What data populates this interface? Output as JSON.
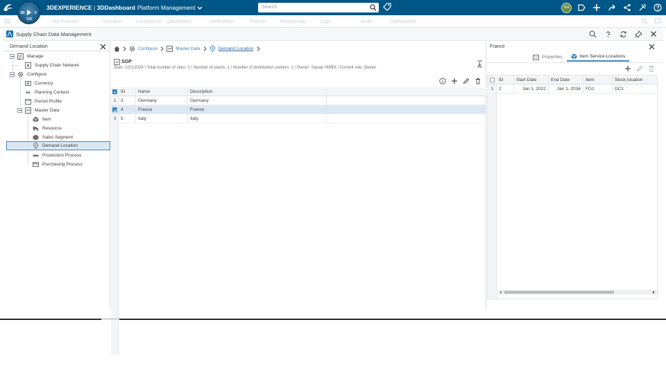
{
  "topbar": {
    "brand_main": "3DEXPERIENCE",
    "brand_sep": " | ",
    "brand_dash": "3DDashboard",
    "brand_tenant": "Platform Management",
    "search_placeholder": "Search",
    "avatar_initials": "SH",
    "compass_left": "3D",
    "compass_right": "V",
    "compass_bottom": "V,R",
    "colors": {
      "bar": "#005686",
      "accent": "#3b86c0"
    }
  },
  "tabstrip": {
    "items": [
      "My Projects",
      "Scenario",
      "Comparison",
      "Dashboard",
      "Verification",
      "Planner",
      "Replanning",
      "Logs",
      "Audit",
      "Dashboards"
    ]
  },
  "app": {
    "title": "Supply Chain Data Management"
  },
  "left_panel": {
    "title": "Demand Location",
    "tree": [
      {
        "label": "Manage",
        "icon": "manage-icon"
      },
      {
        "label": "Supply Chain Network",
        "icon": "network-icon"
      },
      {
        "label": "Configure",
        "icon": "gear-icon"
      },
      {
        "label": "Currency",
        "icon": "currency-icon"
      },
      {
        "label": "Planning Context",
        "icon": "planning-context-icon"
      },
      {
        "label": "Period Profile",
        "icon": "period-profile-icon"
      },
      {
        "label": "Master Data",
        "icon": "master-data-icon"
      },
      {
        "label": "Item",
        "icon": "item-icon"
      },
      {
        "label": "Resource",
        "icon": "resource-icon"
      },
      {
        "label": "Sales Segment",
        "icon": "sales-segment-icon"
      },
      {
        "label": "Demand Location",
        "icon": "location-pin-icon"
      },
      {
        "label": "Production Process",
        "icon": "production-process-icon"
      },
      {
        "label": "Purchasing Process",
        "icon": "purchasing-process-icon"
      }
    ]
  },
  "breadcrumb": {
    "items": [
      "Configure",
      "Master Data",
      "Demand Location"
    ]
  },
  "scenario": {
    "title": "SOP",
    "info": "Start: 10/1/2024 / Total number of sites: 2 / Number of plants: 1 / Number of distribution centers: 1 / Owner: Sanae HIMDI / Current role: Owner"
  },
  "main_grid": {
    "columns": [
      "ID",
      "Name",
      "Description"
    ],
    "rows": [
      {
        "n": "1",
        "id": "3",
        "name": "Germany",
        "description": "Germany",
        "selected": false
      },
      {
        "n": "2",
        "id": "4",
        "name": "France",
        "description": "France",
        "selected": true
      },
      {
        "n": "3",
        "id": "5",
        "name": "Italy",
        "description": "Italy",
        "selected": false
      }
    ]
  },
  "right_panel": {
    "title": "France",
    "tabs": [
      "Properties",
      "Item Service Locations"
    ],
    "active_tab": "Item Service Locations",
    "columns": [
      "ID",
      "Start Date",
      "End Date",
      "Item",
      "Stock location"
    ],
    "rows": [
      {
        "n": "1",
        "id": "2",
        "start": "Jan 1, 2022",
        "end": "Jan 1, 2034",
        "item": "FG1",
        "stock": "DC1"
      }
    ]
  }
}
